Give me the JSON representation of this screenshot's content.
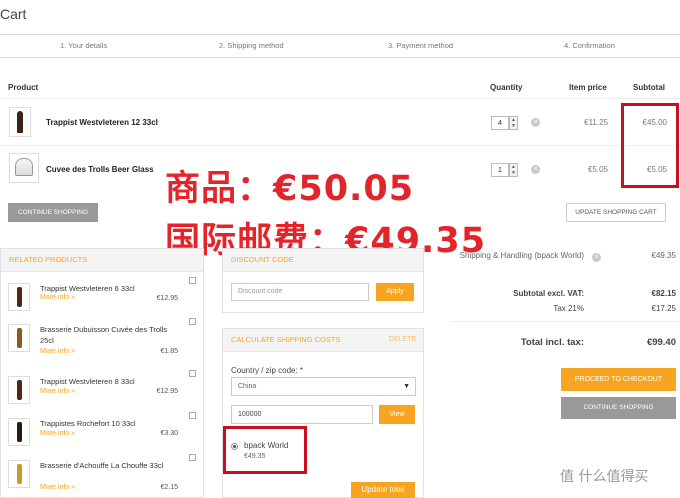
{
  "page": {
    "title": "Cart"
  },
  "steps": [
    "1. Your details",
    "2. Shipping method",
    "3. Payment method",
    "4. Confirmation"
  ],
  "table": {
    "headers": {
      "product": "Product",
      "quantity": "Quantity",
      "item_price": "Item price",
      "subtotal": "Subtotal"
    },
    "rows": [
      {
        "name": "Trappist Westvleteren 12 33cl",
        "qty": "4",
        "item_price": "€11.25",
        "subtotal": "€45.00",
        "image": "beer-bottle-icon"
      },
      {
        "name": "Cuvee des Trolls Beer Glass",
        "qty": "1",
        "item_price": "€5.05",
        "subtotal": "€5.05",
        "image": "beer-glass-icon"
      }
    ]
  },
  "buttons": {
    "continue_top": "CONTINUE SHOPPING",
    "update_cart": "UPDATE SHOPPING CART",
    "apply": "Apply",
    "view": "View",
    "update_total": "Update total",
    "checkout": "PROCEED TO CHECKOUT",
    "continue_bottom": "CONTINUE SHOPPING"
  },
  "overlay": {
    "line1": "商品：€50.05",
    "line2": "国际邮费：€49.35"
  },
  "related": {
    "title": "RELATED PRODUCTS",
    "more_label": "More info »",
    "items": [
      {
        "name": "Trappist Westvleteren 6 33cl",
        "price": "€12.95"
      },
      {
        "name": "Brasserie Dubuisson Cuvée des Trolls 25cl",
        "price": "€1.85"
      },
      {
        "name": "Trappist Westvleteren 8 33cl",
        "price": "€12.95"
      },
      {
        "name": "Trappistes Rochefort 10 33cl",
        "price": "€3.30"
      },
      {
        "name": "Brasserie d'Achouffe La Chouffe 33cl",
        "price": "€2.15"
      }
    ]
  },
  "discount": {
    "title": "DISCOUNT CODE",
    "placeholder": "Discount code"
  },
  "shipping_calc": {
    "title": "CALCULATE SHIPPING COSTS",
    "delete": "DELETE",
    "country_label": "Country / zip code: *",
    "country": "China",
    "zip": "100000",
    "option_name": "bpack World",
    "option_price": "€49.35"
  },
  "summary": {
    "shipping_label": "Shipping & Handling (bpack World)",
    "shipping_val": "€49.35",
    "subtotal_label": "Subtotal excl. VAT:",
    "subtotal_val": "€82.15",
    "tax_label": "Tax 21%",
    "tax_val": "€17.25",
    "total_label": "Total incl. tax:",
    "total_val": "€99.40"
  },
  "watermark": "值 什么值得买",
  "colors": {
    "accent": "#f7a521",
    "annotation_red": "#e3242b",
    "button_grey": "#999999"
  }
}
